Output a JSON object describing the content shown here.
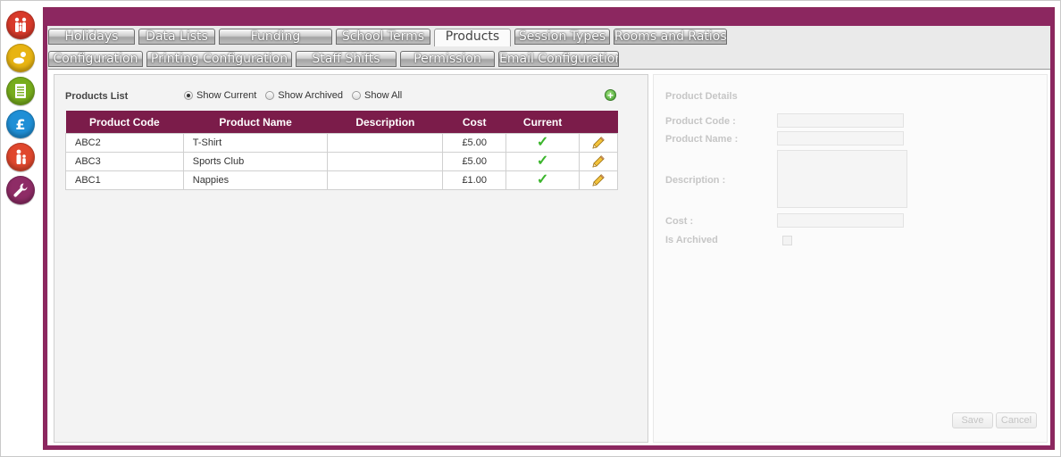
{
  "colors": {
    "brand": "#8c2760",
    "table_header": "#7b1c4a",
    "check_green": "#3bb52c"
  },
  "sidebar": {
    "items": [
      {
        "icon": "family-icon",
        "color": "#d83a2a"
      },
      {
        "icon": "baby-icon",
        "color": "#e8b412"
      },
      {
        "icon": "document-list-icon",
        "color": "#77ad1c"
      },
      {
        "icon": "pound-sterling-icon",
        "color": "#1f8fd6"
      },
      {
        "icon": "child-parent-icon",
        "color": "#e0472d"
      },
      {
        "icon": "wrench-icon",
        "color": "#8e2c66"
      }
    ]
  },
  "tabs": {
    "row1": [
      "Holidays",
      "Data Lists",
      "Funding",
      "School Terms",
      "Products",
      "Session Types",
      "Rooms and Ratios"
    ],
    "row2": [
      "Configuration",
      "Printing Configuration",
      "Staff Shifts",
      "Permission",
      "Email Configuration"
    ],
    "active": "Products"
  },
  "products": {
    "title": "Products List",
    "filters": [
      {
        "label": "Show Current",
        "checked": true
      },
      {
        "label": "Show Archived",
        "checked": false
      },
      {
        "label": "Show All",
        "checked": false
      }
    ],
    "columns": [
      "Product Code",
      "Product Name",
      "Description",
      "Cost",
      "Current"
    ],
    "rows": [
      {
        "code": "ABC2",
        "name": "T-Shirt",
        "description": "",
        "cost": "£5.00",
        "current": true
      },
      {
        "code": "ABC3",
        "name": "Sports Club",
        "description": "",
        "cost": "£5.00",
        "current": true
      },
      {
        "code": "ABC1",
        "name": "Nappies",
        "description": "",
        "cost": "£1.00",
        "current": true
      }
    ]
  },
  "details": {
    "title": "Product Details",
    "labels": {
      "code": "Product Code :",
      "name": "Product Name :",
      "description": "Description :",
      "cost": "Cost :",
      "archived": "Is Archived"
    },
    "save": "Save",
    "cancel": "Cancel"
  }
}
